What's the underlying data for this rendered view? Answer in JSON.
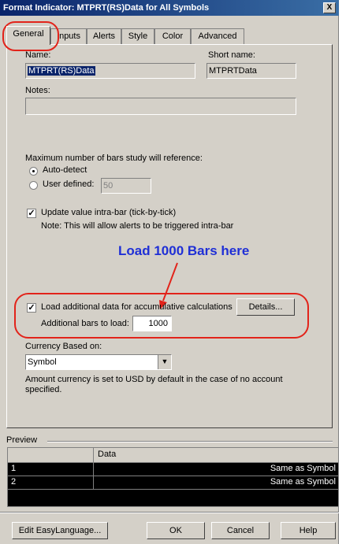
{
  "window": {
    "title": "Format Indicator: MTPRT(RS)Data for All Symbols",
    "close_glyph": "X"
  },
  "tabs": [
    "General",
    "Inputs",
    "Alerts",
    "Style",
    "Color",
    "Advanced"
  ],
  "general": {
    "name_label": "Name:",
    "name_value": "MTPRT(RS)Data",
    "short_name_label": "Short name:",
    "short_name_value": "MTPRTData",
    "notes_label": "Notes:",
    "notes_value": "",
    "max_bars_label": "Maximum number of bars study will reference:",
    "auto_detect_label": "Auto-detect",
    "auto_detect_selected": true,
    "user_defined_label": "User defined:",
    "user_defined_value": "50",
    "update_intrabar_label": "Update value intra-bar (tick-by-tick)",
    "update_intrabar_checked": true,
    "update_note": "Note: This will allow alerts to be triggered intra-bar",
    "load_additional_label": "Load additional data for accumulative calculations",
    "load_additional_checked": true,
    "details_button": "Details...",
    "additional_bars_label": "Additional bars to load:",
    "additional_bars_value": "1000",
    "currency_label": "Currency Based on:",
    "currency_value": "Symbol",
    "currency_note_line1": "Amount currency is set to USD by default in the case of no account",
    "currency_note_line2": "specified."
  },
  "annotation": {
    "text": "Load 1000 Bars here",
    "color": "#1f2fd6",
    "highlight_color": "#e2231a"
  },
  "preview": {
    "label": "Preview",
    "column_header": "Data",
    "rows": [
      {
        "num": "1",
        "value": "Same as Symbol"
      },
      {
        "num": "2",
        "value": "Same as Symbol"
      }
    ]
  },
  "buttons": {
    "edit": "Edit EasyLanguage...",
    "ok": "OK",
    "cancel": "Cancel",
    "help": "Help"
  },
  "icons": {
    "checkmark": "✓",
    "dropdown_arrow": "▼"
  }
}
